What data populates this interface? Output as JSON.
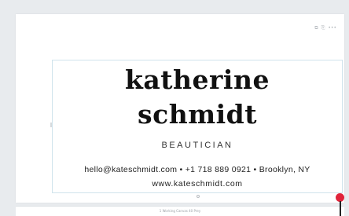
{
  "card_tools": {
    "icons": [
      "duplicate-icon",
      "copy-icon",
      "more-icon"
    ],
    "glyphs": [
      "⧉",
      "⎘",
      "•••"
    ]
  },
  "design": {
    "name_line_1": "katherine",
    "name_line_2": "schmidt",
    "role": "BEAUTICIAN",
    "contact_line": "hello@kateschmidt.com • +1 718 889 0921 • Brooklyn, NY",
    "website": "www.kateschmidt.com"
  },
  "bottom_strip": {
    "label": "1 Working Canvas 40 Prey"
  },
  "colors": {
    "background": "#e8ebee",
    "selection_border": "#cfe3ec",
    "cursor_dot": "#e0243a"
  }
}
